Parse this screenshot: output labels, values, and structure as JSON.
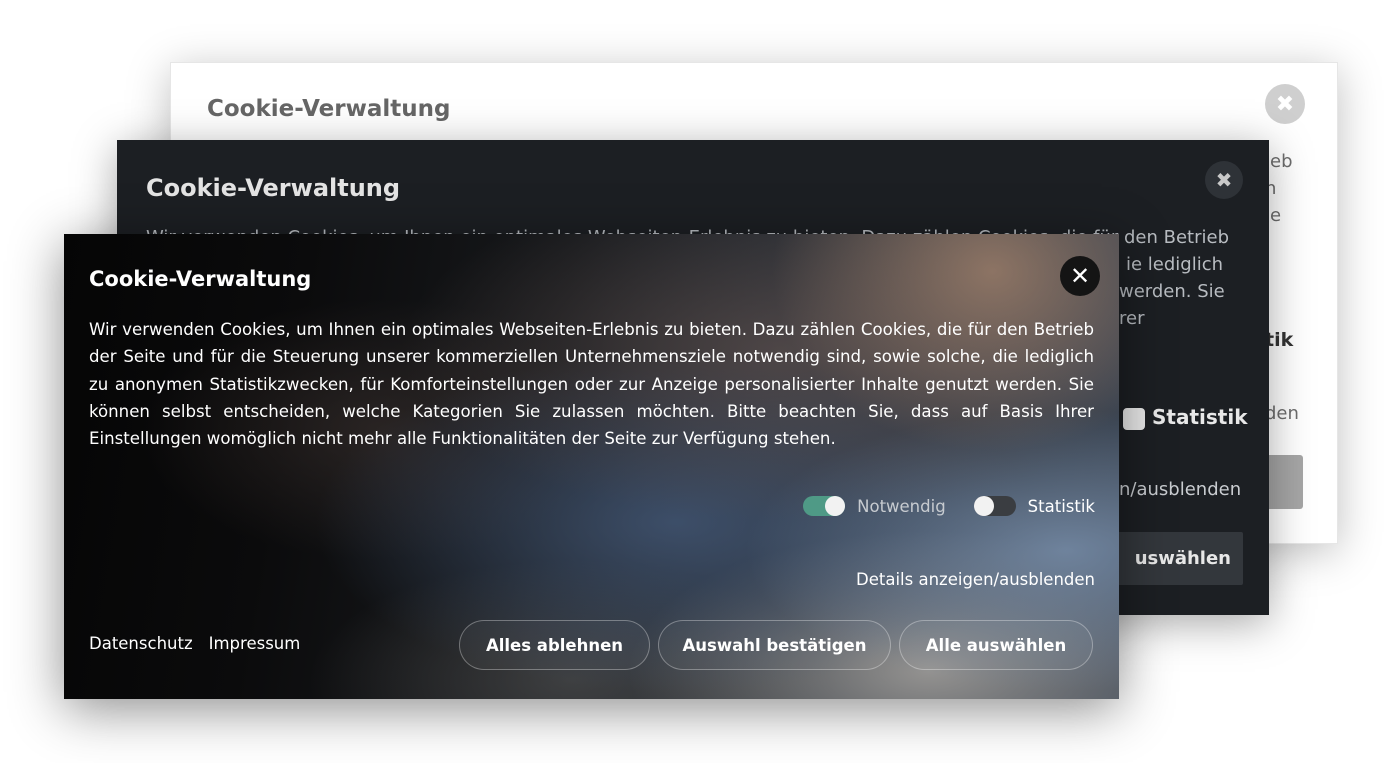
{
  "back_dialog": {
    "title": "Cookie-Verwaltung",
    "close_glyph": "✖",
    "fragments": [
      "ieb",
      "n",
      "ie",
      "tik",
      "den"
    ]
  },
  "mid_dialog": {
    "title": "Cookie-Verwaltung",
    "close_glyph": "✖",
    "fragments": [
      "Wir verwenden Cookies, um Ihnen ein optimales Webseiten-Erlebnis zu bieten. Dazu zählen Cookies, die für den Betrieb",
      "ie lediglich",
      "werden. Sie",
      "rer"
    ],
    "statistik_label": "Statistik",
    "details_fragment": "n/ausblenden",
    "select_fragment": "uswählen"
  },
  "front_dialog": {
    "title": "Cookie-Verwaltung",
    "close_glyph": "✕",
    "body": "Wir verwenden Cookies, um Ihnen ein optimales Webseiten-Erlebnis zu bieten. Dazu zählen Cookies, die für den Betrieb der Seite und für die Steuerung unserer kommerziellen Unternehmensziele notwendig sind, sowie solche, die lediglich zu anonymen Statistikzwecken, für Komforteinstellungen oder zur Anzeige personalisierter Inhalte genutzt werden. Sie können selbst entscheiden, welche Kategorien Sie zulassen möchten. Bitte beachten Sie, dass auf Basis Ihrer Einstellungen womöglich nicht mehr alle Funktionalitäten der Seite zur Verfügung stehen.",
    "toggles": [
      {
        "label": "Notwendig",
        "state": "on"
      },
      {
        "label": "Statistik",
        "state": "off"
      }
    ],
    "details_link": "Details anzeigen/ausblenden",
    "footer_links": [
      "Datenschutz",
      "Impressum"
    ],
    "buttons": {
      "reject_all": "Alles ablehnen",
      "confirm_selection": "Auswahl bestätigen",
      "select_all": "Alle auswählen"
    }
  },
  "colors": {
    "toggle_on": "#4f9a86",
    "toggle_off": "#3a3d41",
    "mid_background": "#1c1f23"
  }
}
